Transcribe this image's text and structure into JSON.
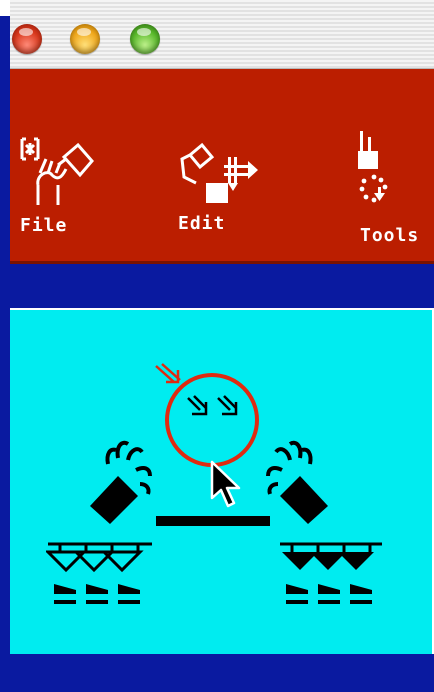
{
  "window": {
    "controls": [
      {
        "name": "close",
        "color": "#e2472b"
      },
      {
        "name": "minimize",
        "color": "#f4b52c"
      },
      {
        "name": "maximize",
        "color": "#6cc63c"
      }
    ]
  },
  "toolbar": {
    "background": "#bb1e00",
    "items": [
      {
        "label": "File",
        "icon": "file-icon"
      },
      {
        "label": "Edit",
        "icon": "edit-icon"
      },
      {
        "label": "Tools",
        "icon": "tools-icon"
      }
    ]
  },
  "canvas": {
    "background": "#00ecf0",
    "elements": [
      {
        "name": "selected-arrows-glyph",
        "icon": "double-arrow-icon",
        "highlight_color": "#e02a10"
      },
      {
        "name": "left-hand-glyph",
        "icon": "hand-icon"
      },
      {
        "name": "right-hand-glyph",
        "icon": "hand-icon"
      },
      {
        "name": "connector-bar",
        "icon": "bar-icon"
      },
      {
        "name": "left-arrow-group",
        "icon": "outline-arrows-icon"
      },
      {
        "name": "right-arrow-group",
        "icon": "filled-arrows-icon"
      },
      {
        "name": "mouse-pointer",
        "icon": "cursor-icon"
      }
    ]
  }
}
